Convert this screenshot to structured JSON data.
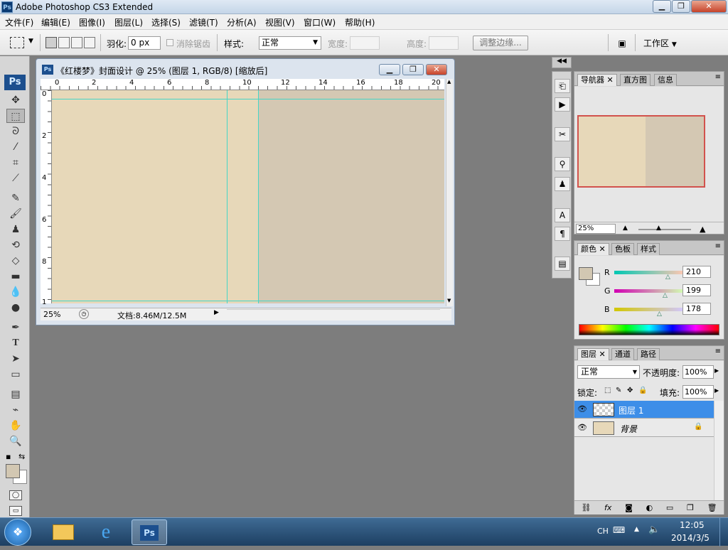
{
  "window": {
    "title": "Adobe Photoshop CS3 Extended",
    "app_icon": "Ps"
  },
  "menu": [
    "文件(F)",
    "编辑(E)",
    "图像(I)",
    "图层(L)",
    "选择(S)",
    "滤镜(T)",
    "分析(A)",
    "视图(V)",
    "窗口(W)",
    "帮助(H)"
  ],
  "options": {
    "feather_label": "羽化:",
    "feather_value": "0 px",
    "antialias_label": "消除锯齿",
    "style_label": "样式:",
    "style_value": "正常",
    "width_label": "宽度:",
    "height_label": "高度:",
    "refine_edge": "调整边缘...",
    "workspace": "工作区"
  },
  "toolbox": {
    "logo": "Ps"
  },
  "document": {
    "title": "《红楼梦》封面设计 @ 25% (图层 1, RGB/8) [缩放后]",
    "zoom": "25%",
    "doc_info": "文档:8.46M/12.5M",
    "ruler_h": [
      "0",
      "2",
      "4",
      "6",
      "8",
      "10",
      "12",
      "14",
      "16",
      "18",
      "20"
    ],
    "ruler_v": [
      "0",
      "2",
      "4",
      "6",
      "8",
      "1"
    ]
  },
  "navigator": {
    "tabs": [
      "导航器",
      "直方图",
      "信息"
    ],
    "zoom": "25%"
  },
  "color": {
    "tabs": [
      "颜色",
      "色板",
      "样式"
    ],
    "r_label": "R",
    "r_value": "210",
    "g_label": "G",
    "g_value": "199",
    "b_label": "B",
    "b_value": "178",
    "swatch": "#d2c7b2"
  },
  "layers": {
    "tabs": [
      "图层",
      "通道",
      "路径"
    ],
    "blend_mode": "正常",
    "opacity_label": "不透明度:",
    "opacity_value": "100%",
    "lock_label": "锁定:",
    "fill_label": "填充:",
    "fill_value": "100%",
    "items": [
      {
        "name": "图层 1",
        "selected": true
      },
      {
        "name": "背景",
        "selected": false
      }
    ]
  },
  "taskbar": {
    "lang": "CH",
    "time": "12:05",
    "date": "2014/3/5"
  }
}
